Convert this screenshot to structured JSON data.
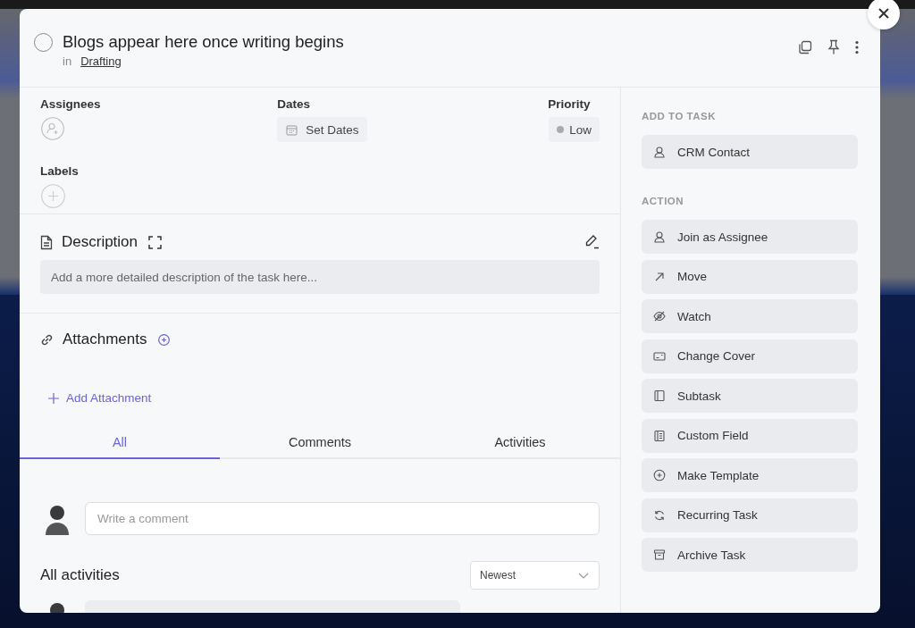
{
  "task": {
    "title": "Blogs appear here once writing begins",
    "completed": false,
    "list_prefix": "in",
    "list": "Drafting"
  },
  "fields": {
    "assignees_label": "Assignees",
    "dates_label": "Dates",
    "dates_button": "Set Dates",
    "priority_label": "Priority",
    "priority": "Low",
    "labels_label": "Labels"
  },
  "description": {
    "title": "Description",
    "placeholder": "Add a more detailed description of the task here..."
  },
  "attachments": {
    "title": "Attachments",
    "add": "Add Attachment"
  },
  "tabs": [
    {
      "label": "All",
      "selected": true
    },
    {
      "label": "Comments",
      "selected": false
    },
    {
      "label": "Activities",
      "selected": false
    }
  ],
  "comment": {
    "placeholder": "Write a comment"
  },
  "activities": {
    "title": "All activities",
    "sort": "Newest"
  },
  "sidebar": {
    "add_heading": "ADD TO TASK",
    "add_items": [
      {
        "label": "CRM Contact",
        "kind": "person"
      }
    ],
    "action_heading": "ACTION",
    "actions": [
      {
        "label": "Join as Assignee",
        "kind": "person"
      },
      {
        "label": "Move",
        "kind": "arrow"
      },
      {
        "label": "Watch",
        "kind": "eye"
      },
      {
        "label": "Change Cover",
        "kind": "cover"
      },
      {
        "label": "Subtask",
        "kind": "panel"
      },
      {
        "label": "Custom Field",
        "kind": "form"
      },
      {
        "label": "Make Template",
        "kind": "plus"
      },
      {
        "label": "Recurring Task",
        "kind": "cycle"
      },
      {
        "label": "Archive Task",
        "kind": "archive"
      }
    ]
  }
}
